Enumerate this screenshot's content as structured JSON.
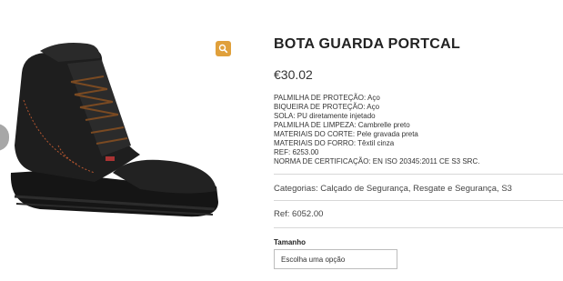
{
  "product": {
    "title": "BOTA GUARDA PORTCAL",
    "price": "€30.02",
    "specs": [
      "PALMILHA DE PROTEÇÃO: Aço",
      "BIQUEIRA DE PROTEÇÃO: Aço",
      "SOLA: PU diretamente injetado",
      "PALMILHA DE LIMPEZA: Cambrelle preto",
      "MATERIAIS DO CORTE: Pele gravada preta",
      "MATERIAIS DO FORRO: Têxtil cinza",
      "REF: 6253.00",
      "NORMA DE CERTIFICAÇÃO: EN ISO 20345:2011 CE S3 SRC."
    ],
    "categories": "Categorias: Calçado de Segurança, Resgate e Segurança, S3",
    "ref": "Ref: 6052.00",
    "size_label": "Tamanho",
    "size_placeholder": "Escolha uma opção"
  },
  "colors": {
    "zoom_button": "#e0a03b",
    "boot": "#1c1c1c",
    "stitching": "#b5562f"
  },
  "icons": {
    "zoom": "magnifier-icon",
    "prev": "chevron-left-icon"
  }
}
